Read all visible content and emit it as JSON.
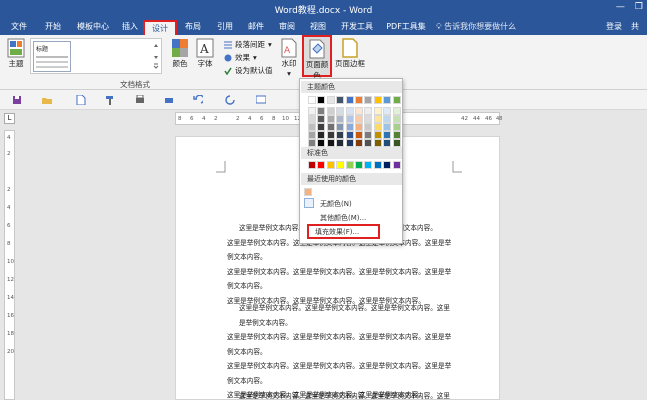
{
  "window": {
    "title": "Word教程.docx - Word",
    "minimize": "—",
    "restore": "❐"
  },
  "tabs": [
    {
      "label": "文件"
    },
    {
      "label": "开始"
    },
    {
      "label": "模板中心"
    },
    {
      "label": "插入"
    },
    {
      "label": "设计"
    },
    {
      "label": "布局"
    },
    {
      "label": "引用"
    },
    {
      "label": "邮件"
    },
    {
      "label": "审阅"
    },
    {
      "label": "视图"
    },
    {
      "label": "开发工具"
    },
    {
      "label": "PDF工具集"
    }
  ],
  "tell_me": {
    "placeholder": "告诉我你想要做什么"
  },
  "account": {
    "signin": "登录",
    "share": "共"
  },
  "ribbon": {
    "theme_label": "主题",
    "style_thumb_text": "标题",
    "group_doc_format": "文档格式",
    "colors_label": "颜色",
    "fonts_label": "字体",
    "paragraph_spacing": "段落间距",
    "effects": "效果",
    "set_default": "设为默认值",
    "watermark": "水印",
    "page_color": "页面颜色",
    "page_border": "页面边框"
  },
  "dropdown": {
    "theme_colors_header": "主题颜色",
    "standard_colors_header": "标准色",
    "recent_colors_header": "最近使用的颜色",
    "no_color": "无颜色(N)",
    "more_colors": "其他颜色(M)...",
    "fill_effects": "填充效果(F)...",
    "theme_top_row": [
      "#ffffff",
      "#000000",
      "#e7e6e6",
      "#44546a",
      "#4472c4",
      "#ed7d31",
      "#a5a5a5",
      "#ffc000",
      "#5b9bd5",
      "#70ad47"
    ],
    "theme_shades": [
      [
        "#f2f2f2",
        "#7f7f7f",
        "#d0cece",
        "#d6dce4",
        "#d9e2f3",
        "#fbe5d5",
        "#ededed",
        "#fff2cc",
        "#deebf6",
        "#e2efd9"
      ],
      [
        "#d8d8d8",
        "#595959",
        "#aeabab",
        "#adb9ca",
        "#b4c6e7",
        "#f7cbac",
        "#dbdbdb",
        "#fee599",
        "#bdd7ee",
        "#c5e0b3"
      ],
      [
        "#bfbfbf",
        "#3f3f3f",
        "#757070",
        "#8496b0",
        "#8eaadb",
        "#f4b183",
        "#c9c9c9",
        "#ffd965",
        "#9dc3e6",
        "#a8d08d"
      ],
      [
        "#a5a5a5",
        "#262626",
        "#3a3838",
        "#323f4f",
        "#2f5496",
        "#c55a11",
        "#7b7b7b",
        "#bf9000",
        "#2e75b5",
        "#538135"
      ],
      [
        "#7f7f7f",
        "#0c0c0c",
        "#171616",
        "#222a35",
        "#1f3864",
        "#833c0b",
        "#525252",
        "#7f6000",
        "#1e4e79",
        "#375623"
      ]
    ],
    "standard_colors": [
      "#c00000",
      "#ff0000",
      "#ffc000",
      "#ffff00",
      "#92d050",
      "#00b050",
      "#00b0f0",
      "#0070c0",
      "#002060",
      "#7030a0"
    ],
    "recent_color": "#f4b183"
  },
  "document": {
    "paragraphs": [
      [
        "这里是举例文本内容。这里是举例文本内容。这里是举例文本内容。",
        "这里是举例文本内容。这里是举例文本内容。这里是举例文本内容。这里是举例文本内容。",
        "这里是举例文本内容。这里是举例文本内容。这里是举例文本内容。这里是举例文本内容。",
        "这里是举例文本内容。这里是举例文本内容。这里是举例文本内容。"
      ],
      [
        "这里是举例文本内容。这里是举例文本内容。这里是举例文本内容。这里是举例文本内容。",
        "这里是举例文本内容。这里是举例文本内容。这里是举例文本内容。这里是举例文本内容。",
        "这里是举例文本内容。这里是举例文本内容。这里是举例文本内容。这里是举例文本内容。",
        "这里是举例文本内容。这里是举例文本内容。这里是举例文本内容。"
      ],
      [
        "这里是举例文本内容。这里是举例文本内容。这里是举例文本内容。这里是举例文本内容。"
      ]
    ]
  },
  "rulers": {
    "horizontal": [
      "8",
      "6",
      "4",
      "2",
      "2",
      "4",
      "6",
      "8",
      "10",
      "12",
      "14",
      "16",
      "18",
      "20",
      "42",
      "44",
      "46",
      "48"
    ],
    "vertical": [
      "4",
      "2",
      "2",
      "4",
      "6",
      "8",
      "10",
      "12",
      "14",
      "16",
      "18",
      "20"
    ]
  },
  "colors": {
    "accent": "#2b579a",
    "highlight": "#e02020"
  }
}
